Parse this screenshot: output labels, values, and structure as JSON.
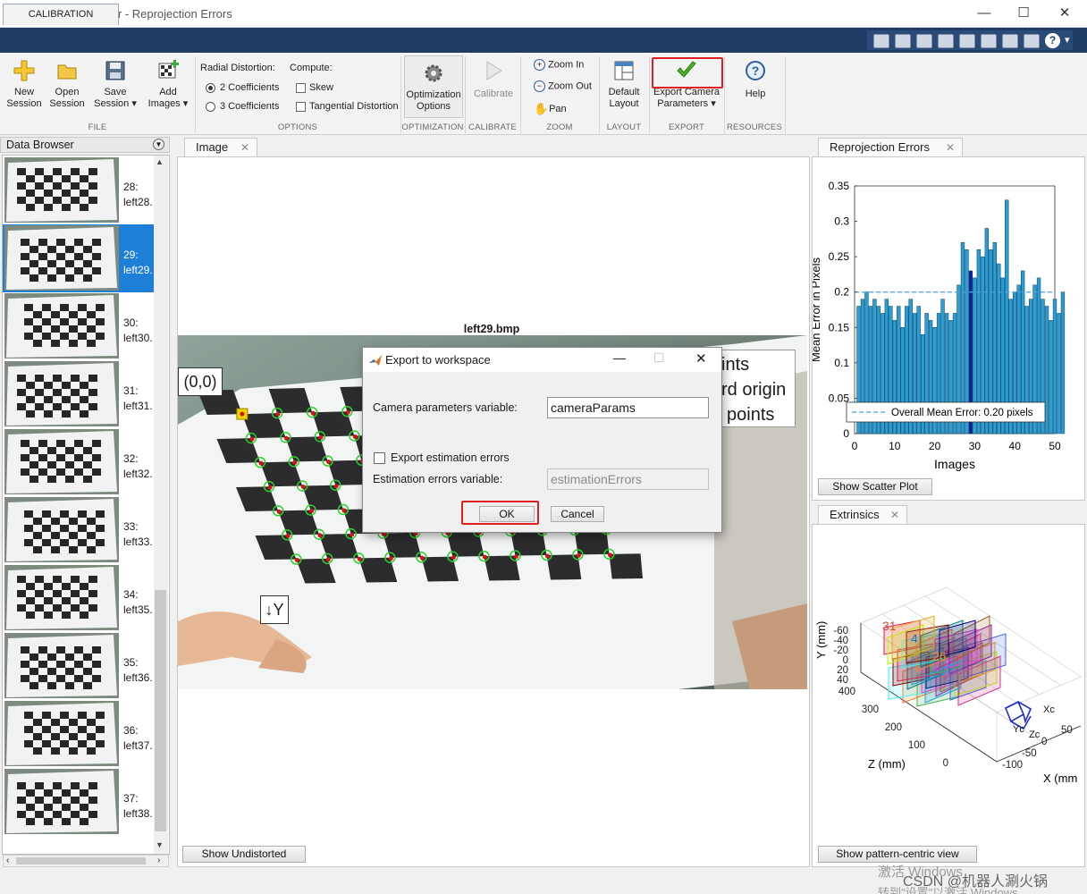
{
  "window": {
    "title": "Camera Calibrator - Reprojection Errors",
    "controls": [
      "—",
      "☐",
      "✕"
    ]
  },
  "ribbon": {
    "tab_label": "CALIBRATION",
    "file": {
      "group_label": "FILE",
      "new_session": [
        "New",
        "Session"
      ],
      "open_session": [
        "Open",
        "Session"
      ],
      "save_session": [
        "Save",
        "Session ▾"
      ],
      "add_images": [
        "Add",
        "Images ▾"
      ]
    },
    "options": {
      "group_label": "OPTIONS",
      "radial_distortion_label": "Radial Distortion:",
      "coeff2": "2 Coefficients",
      "coeff3": "3 Coefficients",
      "compute_label": "Compute:",
      "skew": "Skew",
      "tangential": "Tangential Distortion"
    },
    "optimization": {
      "group_label": "OPTIMIZATION",
      "button": [
        "Optimization",
        "Options"
      ]
    },
    "calibrate": {
      "group_label": "CALIBRATE",
      "button": "Calibrate"
    },
    "zoom": {
      "group_label": "ZOOM",
      "zoom_in": "Zoom In",
      "zoom_out": "Zoom Out",
      "pan": "Pan"
    },
    "layout": {
      "group_label": "LAYOUT",
      "button": [
        "Default",
        "Layout"
      ]
    },
    "export": {
      "group_label": "EXPORT",
      "button": [
        "Export Camera",
        "Parameters ▾"
      ]
    },
    "resources": {
      "group_label": "RESOURCES",
      "help": "Help"
    }
  },
  "data_browser": {
    "title": "Data Browser",
    "items": [
      {
        "num": "28:",
        "name": "left28."
      },
      {
        "num": "29:",
        "name": "left29.",
        "selected": true
      },
      {
        "num": "30:",
        "name": "left30."
      },
      {
        "num": "31:",
        "name": "left31."
      },
      {
        "num": "32:",
        "name": "left32."
      },
      {
        "num": "33:",
        "name": "left33."
      },
      {
        "num": "34:",
        "name": "left35."
      },
      {
        "num": "35:",
        "name": "left36."
      },
      {
        "num": "36:",
        "name": "left37."
      },
      {
        "num": "37:",
        "name": "left38."
      }
    ]
  },
  "image_panel": {
    "tab": "Image",
    "image_title": "left29.bmp",
    "origin_label": "(0,0)",
    "y_label": "↓Y",
    "legend_lines": [
      "ints",
      "rd origin",
      "points"
    ],
    "show_undistorted": "Show Undistorted"
  },
  "reprojection_panel": {
    "tab": "Reprojection Errors",
    "show_scatter": "Show Scatter Plot",
    "colors": {
      "bar": "#2a9fd6",
      "highlight": "#0a1fa0",
      "mean_line": "#4aa3df"
    }
  },
  "chart_data": {
    "type": "bar",
    "x": [
      1,
      2,
      3,
      4,
      5,
      6,
      7,
      8,
      9,
      10,
      11,
      12,
      13,
      14,
      15,
      16,
      17,
      18,
      19,
      20,
      21,
      22,
      23,
      24,
      25,
      26,
      27,
      28,
      29,
      30,
      31,
      32,
      33,
      34,
      35,
      36,
      37,
      38,
      39,
      40,
      41,
      42,
      43,
      44
    ],
    "values": [
      0.18,
      0.19,
      0.2,
      0.18,
      0.19,
      0.18,
      0.17,
      0.19,
      0.18,
      0.16,
      0.18,
      0.15,
      0.18,
      0.19,
      0.17,
      0.18,
      0.14,
      0.17,
      0.16,
      0.15,
      0.17,
      0.19,
      0.17,
      0.16,
      0.17,
      0.21,
      0.27,
      0.26,
      0.23,
      0.22,
      0.26,
      0.25,
      0.29,
      0.26,
      0.27,
      0.24,
      0.22,
      0.33,
      0.19,
      0.2,
      0.21,
      0.23,
      0.18,
      0.19,
      0.21,
      0.22,
      0.19,
      0.18,
      0.16,
      0.19,
      0.17,
      0.2
    ],
    "highlight_index": 29,
    "mean_error": 0.2,
    "legend": "Overall Mean Error: 0.20 pixels",
    "xlabel": "Images",
    "ylabel": "Mean Error in Pixels",
    "xlim": [
      0,
      50
    ],
    "ylim": [
      0,
      0.35
    ],
    "xticks": [
      "0",
      "10",
      "20",
      "30",
      "40",
      "50"
    ],
    "yticks": [
      "0",
      "0.05",
      "0.1",
      "0.15",
      "0.2",
      "0.25",
      "0.3",
      "0.35"
    ]
  },
  "extrinsics_panel": {
    "tab": "Extrinsics",
    "show_pattern": "Show pattern-centric view",
    "y_axis": "Y (mm)",
    "z_axis": "Z (mm)",
    "x_axis": "X (mm",
    "yticks": [
      "-60",
      "-40",
      "-20",
      "0",
      "20",
      "40"
    ],
    "zticks": [
      "400",
      "300",
      "200",
      "100",
      "0"
    ],
    "xticks": [
      "-100",
      "-50",
      "0",
      "50"
    ],
    "cam_labels": [
      "Xc",
      "Yc",
      "Zc"
    ],
    "board_labels": [
      "31",
      "4",
      "26"
    ]
  },
  "dialog": {
    "title": "Export to workspace",
    "camera_params_label": "Camera parameters variable:",
    "camera_params_value": "cameraParams",
    "export_errors_label": "Export estimation errors",
    "errors_var_label": "Estimation errors variable:",
    "errors_var_value": "estimationErrors",
    "ok": "OK",
    "cancel": "Cancel"
  },
  "watermark": {
    "line1": "激活 Windows",
    "csdn": "CSDN @机器人涮火锅",
    "line2": "转到\"设置\"以激活 Windows。"
  }
}
